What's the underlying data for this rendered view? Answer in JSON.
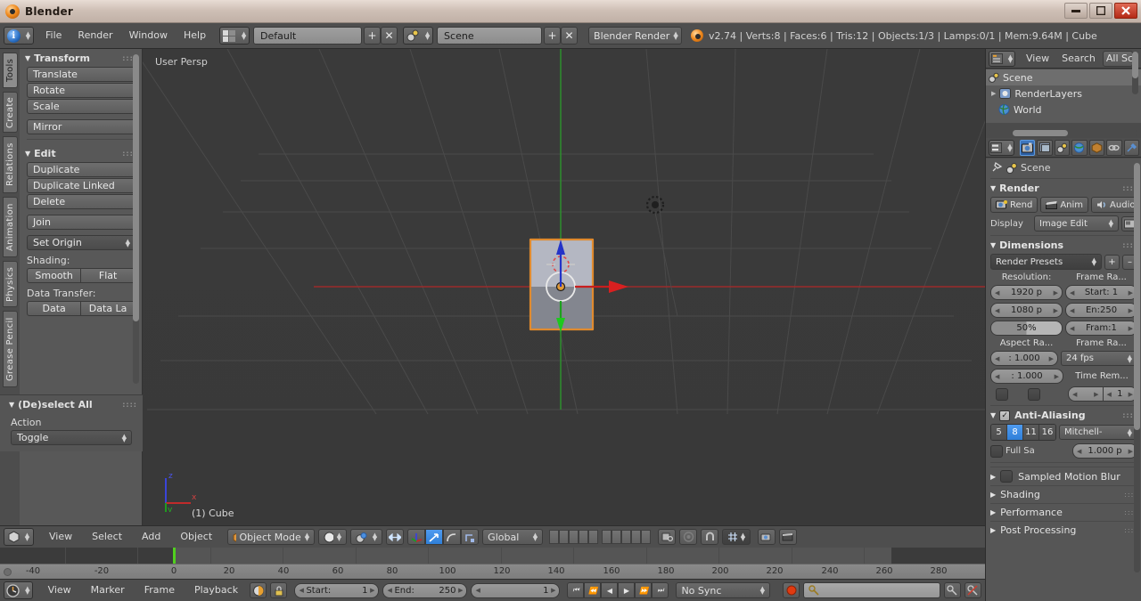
{
  "window": {
    "title": "Blender",
    "app_icon": "blender-logo-icon",
    "minimize": "–",
    "maximize": "□",
    "close": "✕"
  },
  "info_header": {
    "editor_type_icon": "info-editor-icon",
    "menus": [
      "File",
      "Render",
      "Window",
      "Help"
    ],
    "screen_layout": {
      "icon": "screen-layout-icon",
      "value": "Default",
      "add": "+",
      "remove": "✕"
    },
    "scene": {
      "icon": "scene-icon",
      "value": "Scene",
      "add": "+",
      "remove": "✕"
    },
    "render_engine": "Blender Render",
    "status": "v2.74 | Verts:8 | Faces:6 | Tris:12 | Objects:1/3 | Lamps:0/1 | Mem:9.64M | Cube"
  },
  "tool_shelf": {
    "tabs": [
      {
        "label": "Tools",
        "active": true
      },
      {
        "label": "Create",
        "active": false
      },
      {
        "label": "Relations",
        "active": false
      },
      {
        "label": "Animation",
        "active": false
      },
      {
        "label": "Physics",
        "active": false
      },
      {
        "label": "Grease Pencil",
        "active": false
      }
    ],
    "panels": [
      {
        "title": "Transform",
        "buttons": [
          "Translate",
          "Rotate",
          "Scale"
        ],
        "buttons2": [
          "Mirror"
        ]
      },
      {
        "title": "Edit",
        "buttons": [
          "Duplicate",
          "Duplicate Linked",
          "Delete"
        ],
        "buttons2": [
          "Join"
        ],
        "dropdown": "Set Origin",
        "shading_label": "Shading:",
        "shading": [
          "Smooth",
          "Flat"
        ],
        "datatransfer_label": "Data Transfer:",
        "datatransfer": [
          "Data",
          "Data La"
        ]
      }
    ],
    "deselect_panel": {
      "title": "(De)select All",
      "action_label": "Action",
      "action_value": "Toggle"
    }
  },
  "viewport": {
    "view_label": "User Persp",
    "object_label": "(1) Cube",
    "axis_gizmo": {
      "z": "z",
      "x": "x",
      "y": "y"
    },
    "header": {
      "editor_icon": "3d-view-editor-icon",
      "menus": [
        "View",
        "Select",
        "Add",
        "Object"
      ],
      "mode": "Object Mode",
      "mode_icon": "object-mode-icon",
      "shading_icon": "solid-shading-icon",
      "scene_icon": "scene-render-icon",
      "pivot_icon": "pivot-median-icon",
      "manipulator_icons": [
        "manipulator-toggle-icon",
        "translate-manipulator-icon",
        "rotate-manipulator-icon",
        "scale-manipulator-icon"
      ],
      "orientation": "Global",
      "layers_label": "scene-layers-grid",
      "lock_icon": "lock-camera-icon",
      "proportional_icon": "proportional-edit-icon",
      "magnet_icon": "snap-magnet-icon",
      "snap_element": "snap-increment-icon",
      "render_icons": [
        "render-opengl-image-icon",
        "render-opengl-animation-icon"
      ]
    }
  },
  "timeline": {
    "ticks": [
      "-40",
      "-20",
      "0",
      "20",
      "40",
      "60",
      "80",
      "100",
      "120",
      "140",
      "160",
      "180",
      "200",
      "220",
      "240",
      "260",
      "280"
    ],
    "current_frame": 1,
    "header": {
      "editor_icon": "timeline-editor-icon",
      "menus": [
        "View",
        "Marker",
        "Frame",
        "Playback"
      ],
      "autokey_icon": "record-autokey-icon",
      "lock_icon": "lock-icon",
      "start_label": "Start:",
      "start_value": "1",
      "end_label": "End:",
      "end_value": "250",
      "frame_value": "1",
      "transport": [
        "⏮",
        "⏪",
        "◀",
        "▶",
        "⏩",
        "⏭"
      ],
      "sync_mode": "No Sync",
      "record_icon": "record-icon",
      "keying_set_icon": "keying-set-icon",
      "key_add_icon": "key-add-icon",
      "key_remove_icon": "key-remove-icon"
    }
  },
  "outliner": {
    "editor_icon": "outliner-editor-icon",
    "menus": [
      "View",
      "Search"
    ],
    "display_mode": "All Sc",
    "items": [
      {
        "label": "Scene",
        "icon": "scene-icon",
        "selected": true,
        "indent": 0
      },
      {
        "label": "RenderLayers",
        "icon": "renderlayers-icon",
        "selected": false,
        "indent": 1
      },
      {
        "label": "World",
        "icon": "world-icon",
        "selected": false,
        "indent": 1
      }
    ]
  },
  "properties": {
    "editor_icon": "properties-editor-icon",
    "tabs": [
      {
        "name": "render-tab",
        "icon": "camera-back-icon",
        "active": true
      },
      {
        "name": "render-layers-tab",
        "icon": "render-layers-icon",
        "active": false
      },
      {
        "name": "scene-tab",
        "icon": "scene-icon",
        "active": false
      },
      {
        "name": "world-tab",
        "icon": "world-globe-icon",
        "active": false
      },
      {
        "name": "object-tab",
        "icon": "object-cube-icon",
        "active": false
      },
      {
        "name": "constraints-tab",
        "icon": "constraint-chain-icon",
        "active": false
      },
      {
        "name": "modifiers-tab",
        "icon": "wrench-icon",
        "active": false
      }
    ],
    "breadcrumb": {
      "pin_icon": "pin-icon",
      "scene_icon": "scene-icon",
      "label": "Scene"
    },
    "render": {
      "title": "Render",
      "buttons": [
        {
          "label": "Rend",
          "icon": "render-image-icon"
        },
        {
          "label": "Anim",
          "icon": "render-animation-icon"
        },
        {
          "label": "Audio",
          "icon": "render-audio-icon"
        }
      ],
      "display_label": "Display",
      "display_value": "Image Edit",
      "display_icon": "image-editor-icon"
    },
    "dimensions": {
      "title": "Dimensions",
      "presets_label": "Render Presets",
      "preset_add": "+",
      "preset_remove": "–",
      "resolution_label": "Resolution:",
      "resolution_x": "1920 p",
      "resolution_y": "1080 p",
      "resolution_pct": "50%",
      "frame_range_label": "Frame Ra...",
      "frame_start": "Start: 1",
      "frame_end": "En:250",
      "frame_step": "Fram:1",
      "aspect_label": "Aspect Ra...",
      "aspect_x": ": 1.000",
      "aspect_y": ": 1.000",
      "frame_rate_label": "Frame Ra...",
      "frame_rate": "24 fps",
      "time_remap_label": "Time Rem...",
      "time_remap_old": "",
      "time_remap_new": "1",
      "border_checkbox": "border-toggle",
      "crop_checkbox": "crop-toggle"
    },
    "antialiasing": {
      "title": "Anti-Aliasing",
      "enabled": true,
      "samples": [
        "5",
        "8",
        "11",
        "16"
      ],
      "selected_sample": "8",
      "filter": "Mitchell-",
      "full_sample_label": "Full Sa",
      "full_sample_enabled": false,
      "filter_size": "1.000 p"
    },
    "collapsed_sections": [
      {
        "label": "Sampled Motion Blur",
        "has_checkbox": true
      },
      {
        "label": "Shading",
        "has_checkbox": false
      },
      {
        "label": "Performance",
        "has_checkbox": false
      },
      {
        "label": "Post Processing",
        "has_checkbox": false
      }
    ]
  },
  "colors": {
    "header_bg": "#4e4e4e",
    "panel_bg": "#565656",
    "viewport_bg": "#3a3a3a",
    "accent_blue": "#3f78c0",
    "selected_orange": "#e08a2e",
    "axis_x_red": "#9c2b2b",
    "axis_y_green": "#2e8b2e",
    "playhead_green": "#51d01f"
  }
}
